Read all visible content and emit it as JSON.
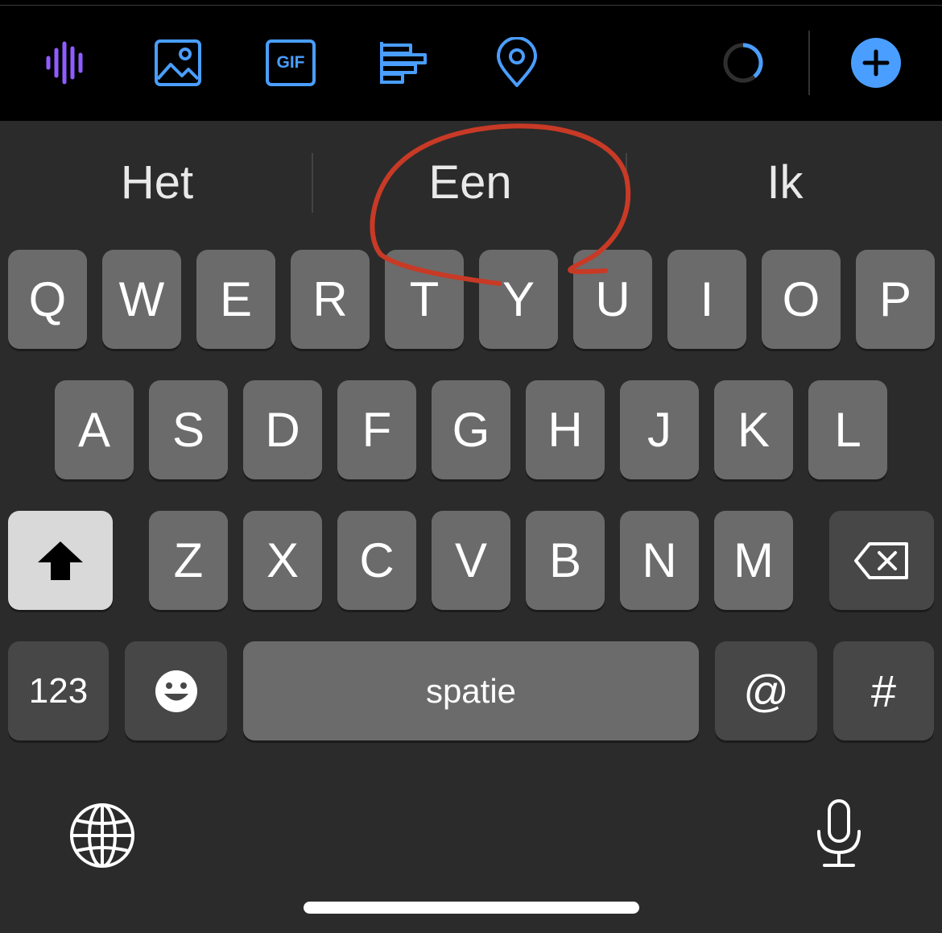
{
  "toolbar": {
    "icons": [
      "audio-waveform-icon",
      "image-icon",
      "gif-icon",
      "poll-icon",
      "location-pin-icon",
      "progress-ring-icon",
      "add-icon"
    ],
    "gif_label": "GIF",
    "colors": {
      "accent": "#4a9eff",
      "audio": "#8f5cff",
      "background": "#000000"
    }
  },
  "suggestions": [
    "Het",
    "Een",
    "Ik"
  ],
  "keyboard": {
    "row1": [
      "Q",
      "W",
      "E",
      "R",
      "T",
      "Y",
      "U",
      "I",
      "O",
      "P"
    ],
    "row2": [
      "A",
      "S",
      "D",
      "F",
      "G",
      "H",
      "J",
      "K",
      "L"
    ],
    "row3": [
      "Z",
      "X",
      "C",
      "V",
      "B",
      "N",
      "M"
    ],
    "numbers_label": "123",
    "space_label": "spatie",
    "at_label": "@",
    "hash_label": "#",
    "bottom_icons": [
      "globe-icon",
      "microphone-icon"
    ]
  },
  "colors": {
    "annotation": "#c83a26",
    "key": "#6b6b6b",
    "key_dark": "#474747",
    "shift_active": "#d9d9d9"
  }
}
